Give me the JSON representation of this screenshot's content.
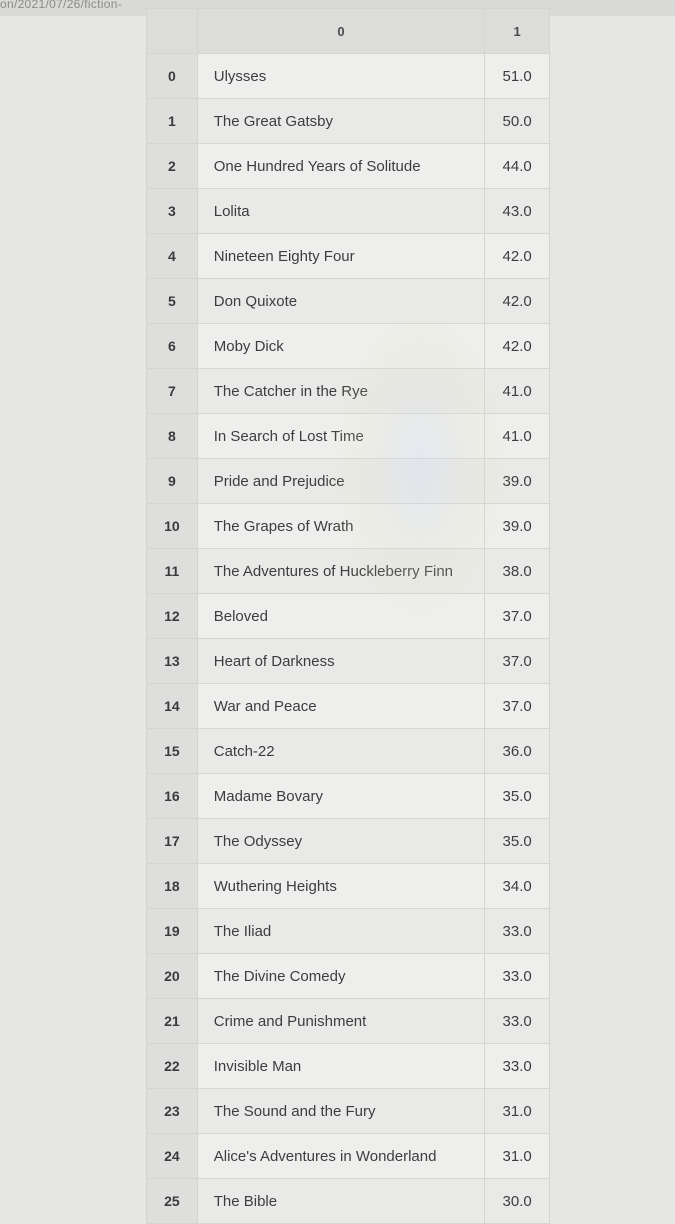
{
  "address_bar": {
    "text": "on/2021/07/26/fiction-"
  },
  "table": {
    "headers": {
      "index": "",
      "col0": "0",
      "col1": "1"
    },
    "rows": [
      {
        "idx": "0",
        "title": "Ulysses",
        "score": "51.0"
      },
      {
        "idx": "1",
        "title": "The Great Gatsby",
        "score": "50.0"
      },
      {
        "idx": "2",
        "title": "One Hundred Years of Solitude",
        "score": "44.0"
      },
      {
        "idx": "3",
        "title": "Lolita",
        "score": "43.0"
      },
      {
        "idx": "4",
        "title": "Nineteen Eighty Four",
        "score": "42.0"
      },
      {
        "idx": "5",
        "title": "Don Quixote",
        "score": "42.0"
      },
      {
        "idx": "6",
        "title": "Moby Dick",
        "score": "42.0"
      },
      {
        "idx": "7",
        "title": "The Catcher in the Rye",
        "score": "41.0"
      },
      {
        "idx": "8",
        "title": "In Search of Lost Time",
        "score": "41.0"
      },
      {
        "idx": "9",
        "title": "Pride and Prejudice",
        "score": "39.0"
      },
      {
        "idx": "10",
        "title": "The Grapes of Wrath",
        "score": "39.0"
      },
      {
        "idx": "11",
        "title": "The Adventures of Huckleberry Finn",
        "score": "38.0"
      },
      {
        "idx": "12",
        "title": "Beloved",
        "score": "37.0"
      },
      {
        "idx": "13",
        "title": "Heart of Darkness",
        "score": "37.0"
      },
      {
        "idx": "14",
        "title": "War and Peace",
        "score": "37.0"
      },
      {
        "idx": "15",
        "title": "Catch-22",
        "score": "36.0"
      },
      {
        "idx": "16",
        "title": "Madame Bovary",
        "score": "35.0"
      },
      {
        "idx": "17",
        "title": "The Odyssey",
        "score": "35.0"
      },
      {
        "idx": "18",
        "title": "Wuthering Heights",
        "score": "34.0"
      },
      {
        "idx": "19",
        "title": "The Iliad",
        "score": "33.0"
      },
      {
        "idx": "20",
        "title": "The Divine Comedy",
        "score": "33.0"
      },
      {
        "idx": "21",
        "title": "Crime and Punishment",
        "score": "33.0"
      },
      {
        "idx": "22",
        "title": "Invisible Man",
        "score": "33.0"
      },
      {
        "idx": "23",
        "title": "The Sound and the Fury",
        "score": "31.0"
      },
      {
        "idx": "24",
        "title": "Alice's Adventures in Wonderland",
        "score": "31.0"
      },
      {
        "idx": "25",
        "title": "The Bible",
        "score": "30.0"
      }
    ]
  }
}
